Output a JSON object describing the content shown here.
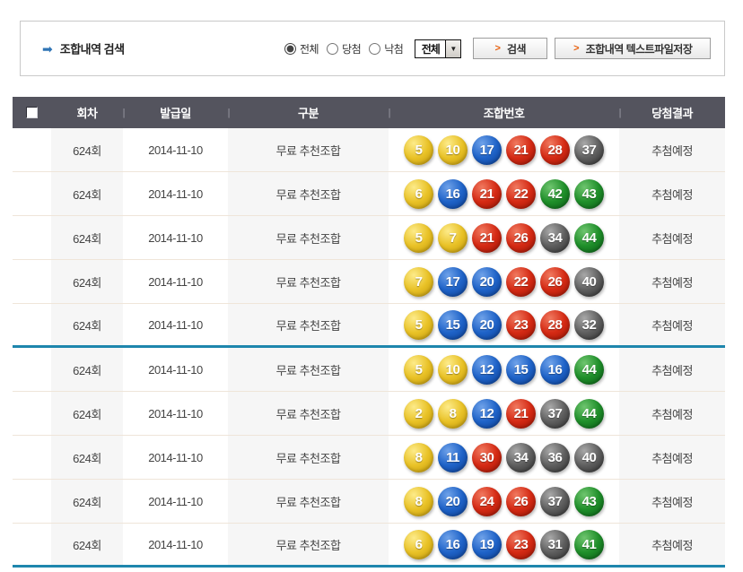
{
  "search": {
    "arrow_icon": "➡",
    "title": "조합내역 검색",
    "radios": [
      {
        "label": "전체",
        "checked": true
      },
      {
        "label": "당첨",
        "checked": false
      },
      {
        "label": "낙첨",
        "checked": false
      }
    ],
    "select_value": "전체",
    "select_arrow": "▼",
    "search_button": {
      "arrow": ">",
      "label": "검색"
    },
    "save_button": {
      "arrow": ">",
      "label": "조합내역 텍스트파일저장"
    }
  },
  "table": {
    "separator": "|",
    "columns": [
      "회차",
      "발급일",
      "구분",
      "조합번호",
      "당첨결과"
    ],
    "rows": [
      {
        "round": "624회",
        "date": "2014-11-10",
        "category": "무료 추천조합",
        "numbers": [
          5,
          10,
          17,
          21,
          28,
          37
        ],
        "result": "추첨예정"
      },
      {
        "round": "624회",
        "date": "2014-11-10",
        "category": "무료 추천조합",
        "numbers": [
          6,
          16,
          21,
          22,
          42,
          43
        ],
        "result": "추첨예정"
      },
      {
        "round": "624회",
        "date": "2014-11-10",
        "category": "무료 추천조합",
        "numbers": [
          5,
          7,
          21,
          26,
          34,
          44
        ],
        "result": "추첨예정"
      },
      {
        "round": "624회",
        "date": "2014-11-10",
        "category": "무료 추천조합",
        "numbers": [
          7,
          17,
          20,
          22,
          26,
          40
        ],
        "result": "추첨예정"
      },
      {
        "round": "624회",
        "date": "2014-11-10",
        "category": "무료 추천조합",
        "numbers": [
          5,
          15,
          20,
          23,
          28,
          32
        ],
        "result": "추첨예정"
      },
      {
        "round": "624회",
        "date": "2014-11-10",
        "category": "무료 추천조합",
        "numbers": [
          5,
          10,
          12,
          15,
          16,
          44
        ],
        "result": "추첨예정"
      },
      {
        "round": "624회",
        "date": "2014-11-10",
        "category": "무료 추천조합",
        "numbers": [
          2,
          8,
          12,
          21,
          37,
          44
        ],
        "result": "추첨예정"
      },
      {
        "round": "624회",
        "date": "2014-11-10",
        "category": "무료 추천조합",
        "numbers": [
          8,
          11,
          30,
          34,
          36,
          40
        ],
        "result": "추첨예정"
      },
      {
        "round": "624회",
        "date": "2014-11-10",
        "category": "무료 추천조합",
        "numbers": [
          8,
          20,
          24,
          26,
          37,
          43
        ],
        "result": "추첨예정"
      },
      {
        "round": "624회",
        "date": "2014-11-10",
        "category": "무료 추천조합",
        "numbers": [
          6,
          16,
          19,
          23,
          31,
          41
        ],
        "result": "추첨예정"
      }
    ],
    "dividers_after": [
      5,
      10
    ]
  },
  "colors": {
    "header_bg": "#54545e",
    "teal_divider": "#1e86ad",
    "row_separator": "#efe5d9",
    "shaded_column_bg": "#f6f6f6",
    "button_arrow_orange": "#e8610f",
    "ball_ranges": {
      "yellow": [
        1,
        10
      ],
      "blue": [
        11,
        20
      ],
      "red": [
        21,
        30
      ],
      "gray": [
        31,
        40
      ],
      "green": [
        41,
        45
      ]
    },
    "ball_colors": {
      "yellow": {
        "hi": "#fdeb8a",
        "mid": "#e9c227",
        "dark": "#c09708"
      },
      "blue": {
        "hi": "#6fa2e9",
        "mid": "#1f63c8",
        "dark": "#0c3e92"
      },
      "red": {
        "hi": "#f0795f",
        "mid": "#d52a14",
        "dark": "#991404"
      },
      "gray": {
        "hi": "#a8a8a8",
        "mid": "#5f5f5f",
        "dark": "#2f2f2f"
      },
      "green": {
        "hi": "#6fc56f",
        "mid": "#1f8f2a",
        "dark": "#0a5c16"
      }
    }
  }
}
